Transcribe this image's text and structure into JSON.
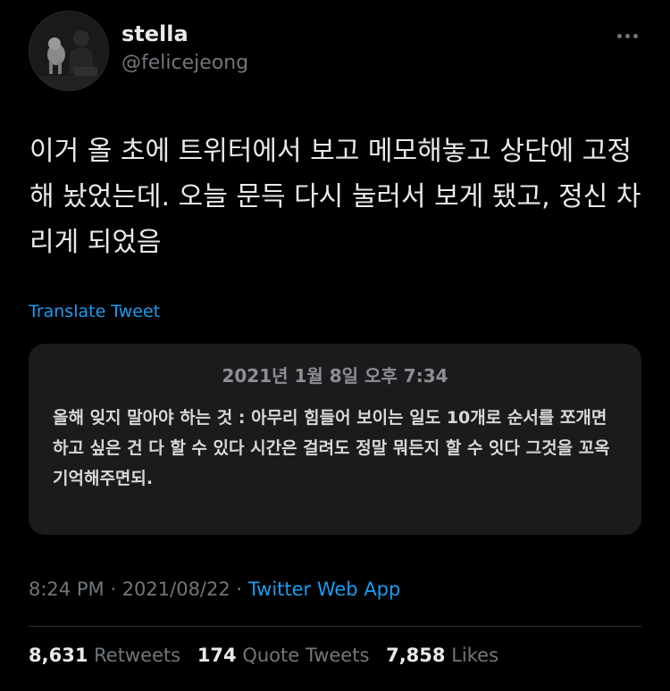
{
  "user": {
    "name": "stella",
    "handle": "@felicejeong"
  },
  "tweet": {
    "text": "이거 올 초에 트위터에서 보고 메모해놓고 상단에 고정해 놨었는데. 오늘 문득 다시 눌러서 보게 됐고, 정신 차리게 되었음",
    "translate_label": "Translate Tweet"
  },
  "memo": {
    "date": "2021년 1월 8일 오후 7:34",
    "body": "올해 잊지 말아야 하는 것 : 아무리 힘들어 보이는 일도 10개로 순서를 쪼개면 하고 싶은 건 다 할 수 있다 시간은 걸려도 정말 뭐든지 할 수 잇다 그것을 꼬옥기억해주면되."
  },
  "meta": {
    "time": "8:24 PM",
    "date": "2021/08/22",
    "separator": "·",
    "app": "Twitter Web App"
  },
  "stats": {
    "retweets": "8,631",
    "retweets_label": "Retweets",
    "quotes": "174",
    "quotes_label": "Quote Tweets",
    "likes": "7,858",
    "likes_label": "Likes"
  },
  "colors": {
    "background": "#000000",
    "link": "#1d9bf0",
    "secondary": "#71767b",
    "card": "#1b1b1d"
  },
  "icons": {
    "more": "more-horizontal-icon"
  }
}
